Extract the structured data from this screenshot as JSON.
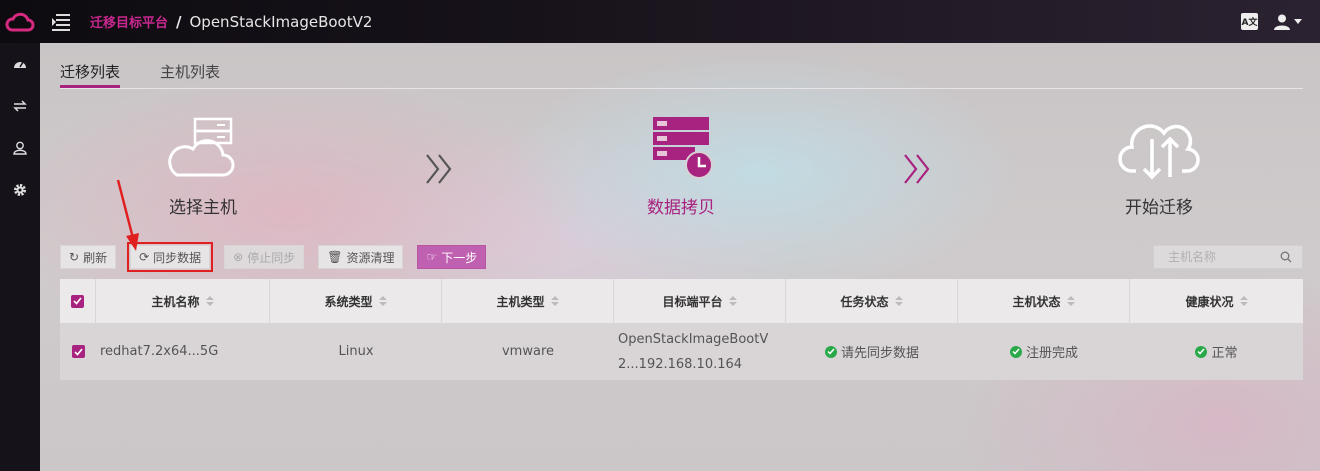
{
  "header": {
    "breadcrumb_parent": "迁移目标平台",
    "separator": "/",
    "breadcrumb_current": "OpenStackImageBootV2"
  },
  "tabs": [
    {
      "label": "迁移列表",
      "active": true
    },
    {
      "label": "主机列表",
      "active": false
    }
  ],
  "steps": [
    {
      "label": "选择主机",
      "icon": "cloud-server-icon",
      "active": false
    },
    {
      "label": "数据拷贝",
      "icon": "server-clock-icon",
      "active": true
    },
    {
      "label": "开始迁移",
      "icon": "cloud-transfer-icon",
      "active": false
    }
  ],
  "toolbar": {
    "refresh": "刷新",
    "sync": "同步数据",
    "stop_sync": "停止同步",
    "cleanup": "资源清理",
    "next": "下一步"
  },
  "search": {
    "placeholder": "主机名称"
  },
  "table": {
    "columns": [
      "主机名称",
      "系统类型",
      "主机类型",
      "目标端平台",
      "任务状态",
      "主机状态",
      "健康状况"
    ],
    "rows": [
      {
        "name": "redhat7.2x64...5G",
        "os": "Linux",
        "type": "vmware",
        "platform_line1": "OpenStackImageBootV",
        "platform_line2": "2...192.168.10.164",
        "task_status": "请先同步数据",
        "host_status": "注册完成",
        "health": "正常"
      }
    ]
  },
  "colors": {
    "accent": "#a8227f",
    "success": "#2aa84a",
    "highlight": "#e02020"
  }
}
